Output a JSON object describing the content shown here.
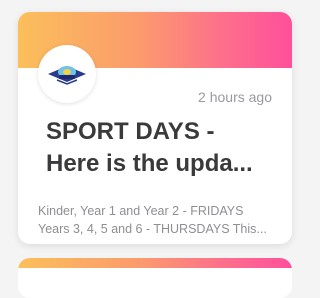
{
  "card": {
    "timestamp": "2 hours ago",
    "title_lines": [
      "SPORT DAYS -",
      "Here is the upda..."
    ],
    "excerpt_lines": [
      "Kinder, Year 1 and Year 2 - FRIDAYS",
      "Years 3, 4, 5 and 6 - THURSDAYS This..."
    ],
    "avatar_icon": "school-crest-icon",
    "banner_colors": [
      "#fbbf5a",
      "#ff4f9a"
    ]
  },
  "next_card": {
    "banner_colors": [
      "#fbbf5a",
      "#ff4f9a"
    ]
  }
}
